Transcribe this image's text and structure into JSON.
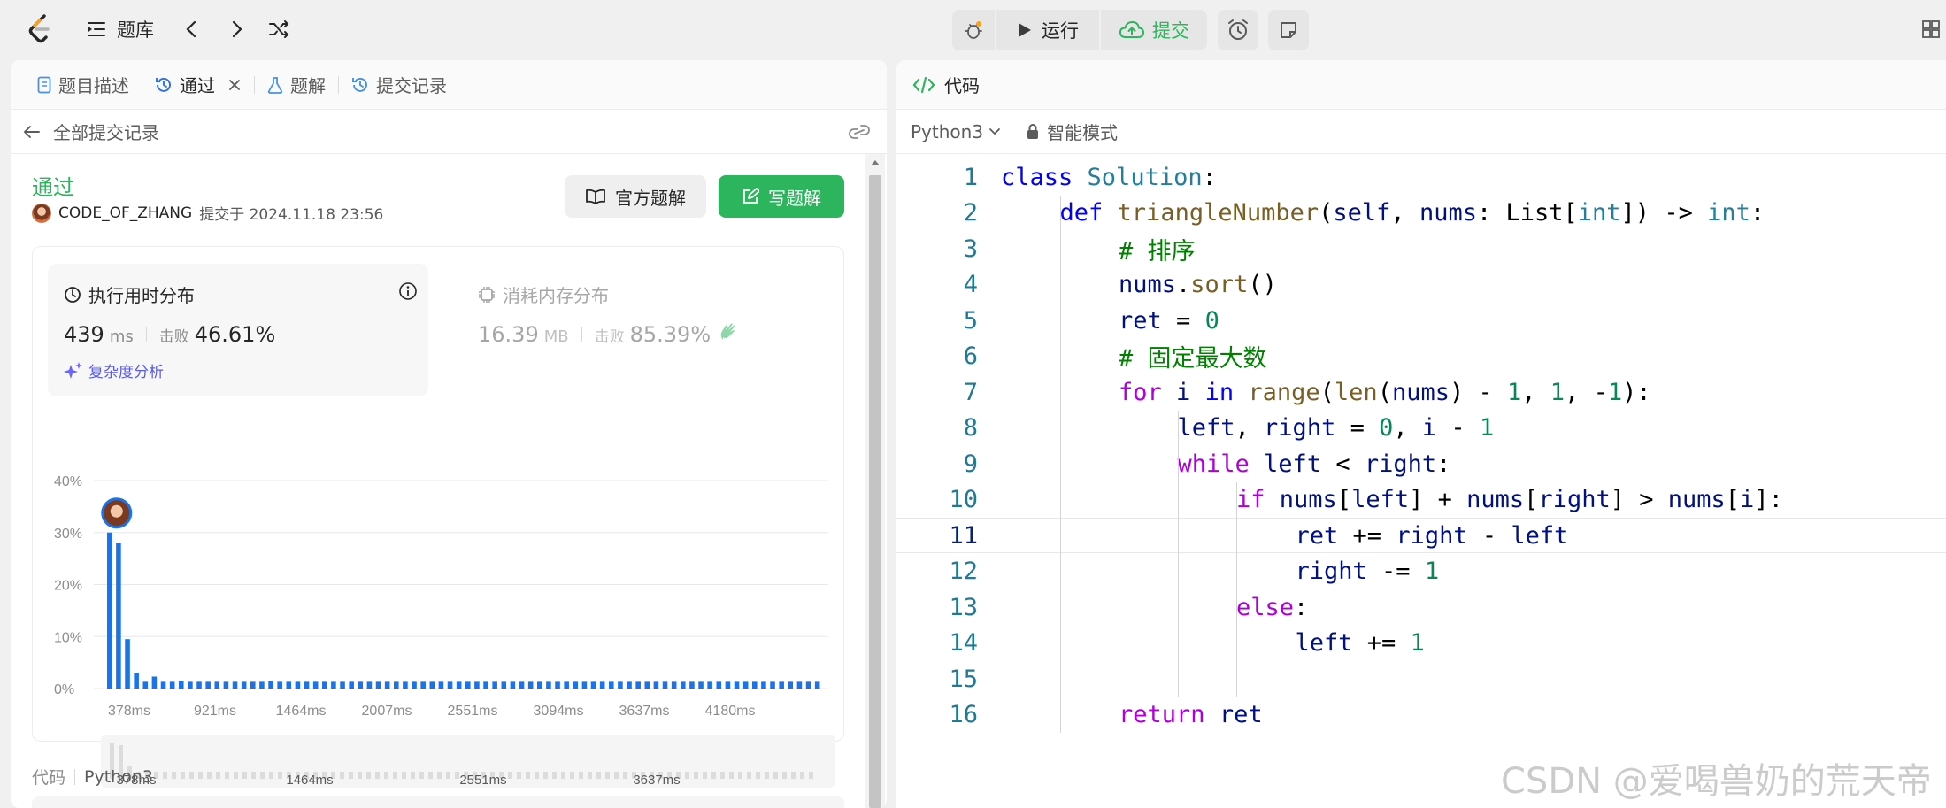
{
  "topbar": {
    "problem_bank": "题库",
    "run": "运行",
    "submit": "提交"
  },
  "tabs": {
    "description": "题目描述",
    "passed": "通过",
    "solutions": "题解",
    "submissions": "提交记录"
  },
  "subbar": {
    "back_label": "全部提交记录"
  },
  "submission": {
    "status": "通过",
    "username": "CODE_OF_ZHANG",
    "submitted_at": "提交于 2024.11.18 23:56",
    "official_solution": "官方题解",
    "write_solution": "写题解"
  },
  "runtime": {
    "title": "执行用时分布",
    "value": "439",
    "unit": "ms",
    "beat_label": "击败",
    "beat_value": "46.61%",
    "complexity": "复杂度分析"
  },
  "memory": {
    "title": "消耗内存分布",
    "value": "16.39",
    "unit": "MB",
    "beat_label": "击败",
    "beat_value": "85.39%"
  },
  "chart_data": {
    "type": "bar",
    "ylim": [
      0,
      40
    ],
    "y_ticks": [
      "40%",
      "30%",
      "20%",
      "10%",
      "0%"
    ],
    "x_tick_labels": [
      "378ms",
      "921ms",
      "1464ms",
      "2007ms",
      "2551ms",
      "3094ms",
      "3637ms",
      "4180ms"
    ],
    "values": [
      30,
      28,
      9.5,
      3,
      1.3,
      2.3,
      1.3,
      1.3,
      1.5,
      1.3,
      1.3,
      1.3,
      1.3,
      1.3,
      1.3,
      1.3,
      1.3,
      1.3,
      1.5,
      1.3,
      1.3,
      1.3,
      1.3,
      1.3,
      1.3,
      1.3,
      1.3,
      1.3,
      1.3,
      1.3,
      1.3,
      1.3,
      1.3,
      1.3,
      1.3,
      1.3,
      1.3,
      1.3,
      1.3,
      1.3,
      1.3,
      1.3,
      1.3,
      1.3,
      1.3,
      1.3,
      1.3,
      1.3,
      1.3,
      1.3,
      1.3,
      1.3,
      1.3,
      1.3,
      1.3,
      1.3,
      1.3,
      1.3,
      1.3,
      1.3,
      1.3,
      1.3,
      1.3,
      1.3,
      1.3,
      1.3,
      1.3,
      1.3,
      1.3,
      1.3,
      1.3,
      1.3,
      1.3,
      1.3,
      1.3,
      1.3,
      1.3,
      1.3,
      1.3,
      1.3
    ],
    "bar_color": "#1a73e8",
    "user_bar_index": 0,
    "brush_tick_labels": [
      "378ms",
      "1464ms",
      "2551ms",
      "3637ms"
    ]
  },
  "code_footer": {
    "label": "代码",
    "language": "Python3"
  },
  "editor": {
    "tab_label": "代码",
    "language": "Python3",
    "mode": "智能模式",
    "current_line": 11,
    "lines": [
      {
        "n": "1",
        "indent": 0,
        "html": "<span class='kw'>class</span> <span class='cls'>Solution</span>:"
      },
      {
        "n": "2",
        "indent": 1,
        "html": "<span class='kw'>def</span> <span class='fn'>triangleNumber</span>(<span class='param'>self</span>, <span class='param'>nums</span>: List[<span class='cls'>int</span>]) -&gt; <span class='cls'>int</span>:"
      },
      {
        "n": "3",
        "indent": 2,
        "html": "<span class='cmt'># 排序</span>"
      },
      {
        "n": "4",
        "indent": 2,
        "html": "<span class='param'>nums</span>.<span class='fn'>sort</span>()"
      },
      {
        "n": "5",
        "indent": 2,
        "html": "<span class='param'>ret</span> = <span class='num'>0</span>"
      },
      {
        "n": "6",
        "indent": 2,
        "html": "<span class='cmt'># 固定最大数</span>"
      },
      {
        "n": "7",
        "indent": 2,
        "html": "<span class='kw2'>for</span> <span class='param'>i</span> <span class='kw'>in</span> <span class='fn'>range</span>(<span class='fn'>len</span>(<span class='param'>nums</span>) - <span class='num'>1</span>, <span class='num'>1</span>, -<span class='num'>1</span>):"
      },
      {
        "n": "8",
        "indent": 3,
        "html": "<span class='param'>left</span>, <span class='param'>right</span> = <span class='num'>0</span>, <span class='param'>i</span> - <span class='num'>1</span>"
      },
      {
        "n": "9",
        "indent": 3,
        "html": "<span class='kw2'>while</span> <span class='param'>left</span> &lt; <span class='param'>right</span>:"
      },
      {
        "n": "10",
        "indent": 4,
        "html": "<span class='kw2'>if</span> <span class='param'>nums</span>[<span class='param'>left</span>] + <span class='param'>nums</span>[<span class='param'>right</span>] &gt; <span class='param'>nums</span>[<span class='param'>i</span>]:"
      },
      {
        "n": "11",
        "indent": 5,
        "html": "<span class='param'>ret</span> += <span class='param'>right</span> - <span class='param'>left</span>"
      },
      {
        "n": "12",
        "indent": 5,
        "html": "<span class='param'>right</span> -= <span class='num'>1</span>"
      },
      {
        "n": "13",
        "indent": 4,
        "html": "<span class='kw2'>else</span>:"
      },
      {
        "n": "14",
        "indent": 5,
        "html": "<span class='param'>left</span> += <span class='num'>1</span>"
      },
      {
        "n": "15",
        "indent": 0,
        "html": ""
      },
      {
        "n": "16",
        "indent": 2,
        "html": "<span class='kw2'>return</span> <span class='param'>ret</span>"
      }
    ]
  },
  "watermark": "CSDN @爱喝兽奶的荒天帝"
}
